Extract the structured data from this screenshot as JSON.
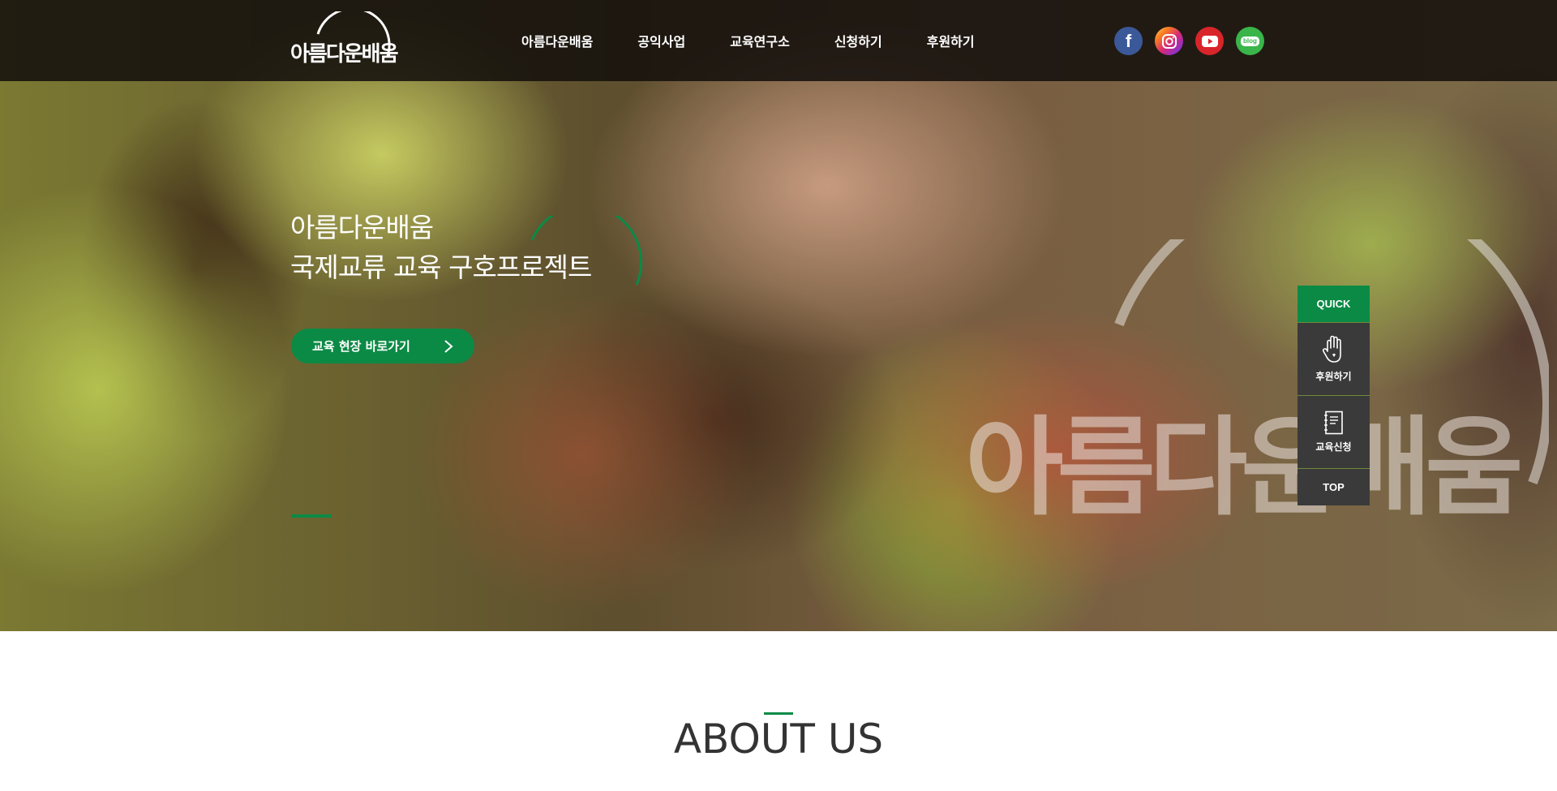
{
  "header": {
    "logo_text": "아름다운배움",
    "nav": [
      "아름다운배움",
      "공익사업",
      "교육연구소",
      "신청하기",
      "후원하기"
    ],
    "social": [
      {
        "name": "facebook",
        "icon": "facebook-icon",
        "color": "#3b5998",
        "glyph": "f"
      },
      {
        "name": "instagram",
        "icon": "instagram-icon",
        "color": "#d62976"
      },
      {
        "name": "youtube",
        "icon": "youtube-icon",
        "color": "#d9252a"
      },
      {
        "name": "blog",
        "icon": "blog-icon",
        "color": "#3ab54a",
        "glyph": "blog"
      }
    ]
  },
  "hero": {
    "title_line1": "아름다운배움",
    "title_line2": "국제교류 교육 구호프로젝트",
    "button_label": "교육 현장 바로가기",
    "watermark_text": "아름다운배움",
    "accent_color": "#0b8a45"
  },
  "quick_menu": {
    "title": "QUICK",
    "items": [
      {
        "label": "후원하기",
        "icon": "hand-icon"
      },
      {
        "label": "교육신청",
        "icon": "notebook-icon"
      }
    ],
    "top_label": "TOP"
  },
  "about": {
    "title": "ABOUT US"
  }
}
